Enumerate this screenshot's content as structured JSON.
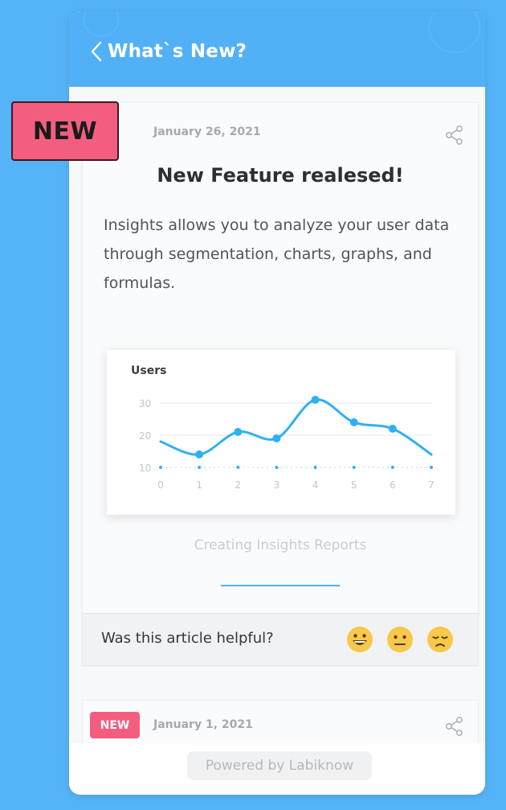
{
  "header": {
    "back_label": "What`s New?"
  },
  "badge": {
    "label": "NEW",
    "color": "#f35e80"
  },
  "article": {
    "date": "January 26, 2021",
    "title": "New Feature realesed!",
    "body": "Insights allows you to analyze your user data through segmentation, charts, graphs, and formulas.",
    "caption": "Creating Insights Reports"
  },
  "chart_data": {
    "type": "line",
    "title": "Users",
    "x": [
      0,
      1,
      2,
      3,
      4,
      5,
      6,
      7
    ],
    "y": [
      18,
      14,
      21,
      19,
      31,
      24,
      22,
      14
    ],
    "ylim": [
      10,
      30
    ],
    "yticks": [
      10,
      20,
      30
    ],
    "grid": true,
    "color": "#2fb0f2"
  },
  "feedback": {
    "question": "Was this article helpful?",
    "emojis": [
      "grinning-face-icon",
      "neutral-face-icon",
      "disappointed-face-icon"
    ]
  },
  "article2": {
    "badge": "NEW",
    "date": "January 1, 2021"
  },
  "footer": {
    "powered_by": "Powered by Labiknow"
  },
  "colors": {
    "background": "#55b4f8",
    "header": "#52b1f6",
    "accent": "#52b1f6",
    "badge": "#f35e80"
  }
}
